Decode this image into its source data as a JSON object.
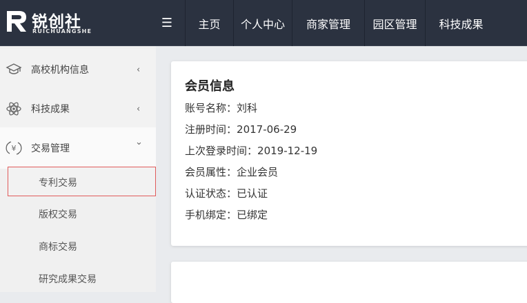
{
  "header": {
    "logo_title": "锐创社",
    "logo_subtitle": "RUICHUANGSHE",
    "menu_icon": "hamburger-icon",
    "nav": [
      "主页",
      "个人中心",
      "商家管理",
      "园区管理",
      "科技成果"
    ]
  },
  "sidebar": {
    "groups": [
      {
        "label": "高校机构信息",
        "icon": "graduation-cap-icon",
        "chevron": "‹",
        "expanded": false
      },
      {
        "label": "科技成果",
        "icon": "atom-icon",
        "chevron": "‹",
        "expanded": false
      },
      {
        "label": "交易管理",
        "icon": "trade-icon",
        "chevron": "⌄",
        "expanded": true
      }
    ],
    "subitems": [
      "专利交易",
      "版权交易",
      "商标交易",
      "研究成果交易"
    ],
    "active_subitem": "专利交易"
  },
  "member_info": {
    "title": "会员信息",
    "rows": [
      {
        "label": "账号名称",
        "value": "刘科"
      },
      {
        "label": "注册时间",
        "value": "2017-06-29"
      },
      {
        "label": "上次登录时间",
        "value": "2019-12-19"
      },
      {
        "label": "会员属性",
        "value": "企业会员"
      },
      {
        "label": "认证状态",
        "value": "已认证"
      },
      {
        "label": "手机绑定",
        "value": "已绑定"
      }
    ],
    "separator": "："
  },
  "colors": {
    "topbar": "#2b3240",
    "active_border": "#e05a5a",
    "sidebar_bg": "#f0f0f0"
  }
}
